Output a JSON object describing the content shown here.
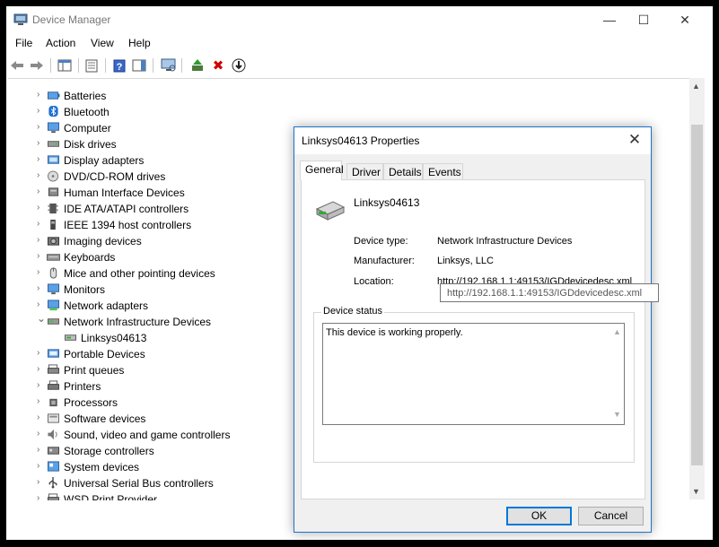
{
  "window": {
    "title": "Device Manager",
    "controls": {
      "minimize": "—",
      "maximize": "☐",
      "close": "✕"
    }
  },
  "menu": [
    "File",
    "Action",
    "View",
    "Help"
  ],
  "tree": {
    "items": [
      {
        "label": "Batteries",
        "icon": "battery-icon",
        "expanded": false
      },
      {
        "label": "Bluetooth",
        "icon": "bluetooth-icon",
        "expanded": false
      },
      {
        "label": "Computer",
        "icon": "computer-icon",
        "expanded": false
      },
      {
        "label": "Disk drives",
        "icon": "disk-drive-icon",
        "expanded": false
      },
      {
        "label": "Display adapters",
        "icon": "display-adapter-icon",
        "expanded": false
      },
      {
        "label": "DVD/CD-ROM drives",
        "icon": "dvd-icon",
        "expanded": false
      },
      {
        "label": "Human Interface Devices",
        "icon": "hid-icon",
        "expanded": false
      },
      {
        "label": "IDE ATA/ATAPI controllers",
        "icon": "ide-controller-icon",
        "expanded": false
      },
      {
        "label": "IEEE 1394 host controllers",
        "icon": "ieee1394-icon",
        "expanded": false
      },
      {
        "label": "Imaging devices",
        "icon": "camera-icon",
        "expanded": false
      },
      {
        "label": "Keyboards",
        "icon": "keyboard-icon",
        "expanded": false
      },
      {
        "label": "Mice and other pointing devices",
        "icon": "mouse-icon",
        "expanded": false
      },
      {
        "label": "Monitors",
        "icon": "monitor-icon",
        "expanded": false
      },
      {
        "label": "Network adapters",
        "icon": "network-adapter-icon",
        "expanded": false
      },
      {
        "label": "Network Infrastructure Devices",
        "icon": "network-infrastructure-icon",
        "expanded": true
      },
      {
        "label": "Linksys04613",
        "icon": "router-icon",
        "child": true
      },
      {
        "label": "Portable Devices",
        "icon": "portable-device-icon",
        "expanded": false
      },
      {
        "label": "Print queues",
        "icon": "print-queue-icon",
        "expanded": false
      },
      {
        "label": "Printers",
        "icon": "printer-icon",
        "expanded": false
      },
      {
        "label": "Processors",
        "icon": "processor-icon",
        "expanded": false
      },
      {
        "label": "Software devices",
        "icon": "software-device-icon",
        "expanded": false
      },
      {
        "label": "Sound, video and game controllers",
        "icon": "sound-icon",
        "expanded": false
      },
      {
        "label": "Storage controllers",
        "icon": "storage-controller-icon",
        "expanded": false
      },
      {
        "label": "System devices",
        "icon": "system-device-icon",
        "expanded": false
      },
      {
        "label": "Universal Serial Bus controllers",
        "icon": "usb-icon",
        "expanded": false
      },
      {
        "label": "WSD Print Provider",
        "icon": "wsd-printer-icon",
        "expanded": false
      }
    ]
  },
  "dialog": {
    "title": "Linksys04613 Properties",
    "tabs": [
      "General",
      "Driver",
      "Details",
      "Events"
    ],
    "active_tab": "General",
    "device_name": "Linksys04613",
    "properties": [
      {
        "label": "Device type:",
        "value": "Network Infrastructure Devices"
      },
      {
        "label": "Manufacturer:",
        "value": "Linksys, LLC"
      },
      {
        "label": "Location:",
        "value": "http://192.168.1.1:49153/IGDdevicedesc.xml"
      }
    ],
    "status_group_label": "Device status",
    "status_text": "This device is working properly.",
    "ok_label": "OK",
    "cancel_label": "Cancel"
  },
  "tooltip": "http://192.168.1.1:49153/IGDdevicedesc.xml",
  "colors": {
    "accent": "#0078d7",
    "dialog_border": "#1e73c9",
    "annotation_arrow": "#e41b1b"
  }
}
